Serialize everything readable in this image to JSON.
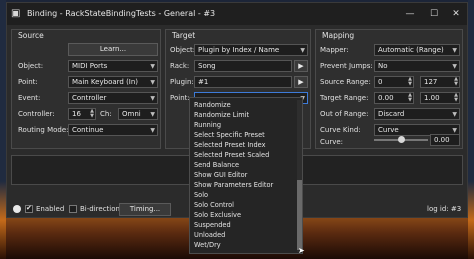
{
  "window": {
    "title": "Binding - RackStateBindingTests - General - #3",
    "icon": "app-icon",
    "buttons": {
      "minimize": "—",
      "maximize": "☐",
      "close": "✕"
    }
  },
  "source": {
    "title": "Source",
    "learn_label": "Learn...",
    "object": {
      "label": "Object:",
      "value": "MIDI Ports"
    },
    "point": {
      "label": "Point:",
      "value": "Main Keyboard (In)"
    },
    "event": {
      "label": "Event:",
      "value": "Controller"
    },
    "controller": {
      "label": "Controller:",
      "value": "16"
    },
    "channel": {
      "label": "Ch:",
      "value": "Omni"
    },
    "routing": {
      "label": "Routing Mode:",
      "value": "Continue"
    }
  },
  "target": {
    "title": "Target",
    "object": {
      "label": "Object:",
      "value": "Plugin by Index / Name"
    },
    "rack": {
      "label": "Rack:",
      "value": "Song",
      "button": "▶"
    },
    "plugin": {
      "label": "Plugin:",
      "value": "#1",
      "button": "▶"
    },
    "point": {
      "label": "Point:",
      "value": ""
    },
    "dropdown_items": [
      "Randomize",
      "Randomize Limit",
      "Running",
      "Select Specific Preset",
      "Selected Preset Index",
      "Selected Preset Scaled",
      "Send Balance",
      "Show GUI Editor",
      "Show Parameters Editor",
      "Solo",
      "Solo Control",
      "Solo Exclusive",
      "Suspended",
      "Unloaded",
      "Wet/Dry"
    ]
  },
  "mapping": {
    "title": "Mapping",
    "mapper": {
      "label": "Mapper:",
      "value": "Automatic (Range)"
    },
    "prevent_jumps": {
      "label": "Prevent Jumps:",
      "value": "No"
    },
    "source_range": {
      "label": "Source Range:",
      "min": "0",
      "max": "127"
    },
    "target_range": {
      "label": "Target Range:",
      "min": "0.00",
      "max": "1.00"
    },
    "out_of_range": {
      "label": "Out of Range:",
      "value": "Discard"
    },
    "curve_kind": {
      "label": "Curve Kind:",
      "value": "Curve"
    },
    "curve": {
      "label": "Curve:",
      "value": "0.00",
      "level": 0.5
    }
  },
  "bottom": {
    "enabled_label": "Enabled",
    "enabled_checked": true,
    "bidirectional_label": "Bi-directional",
    "bidirectional_checked": false,
    "timing_label": "Timing...",
    "log_label": "log id: #3"
  }
}
